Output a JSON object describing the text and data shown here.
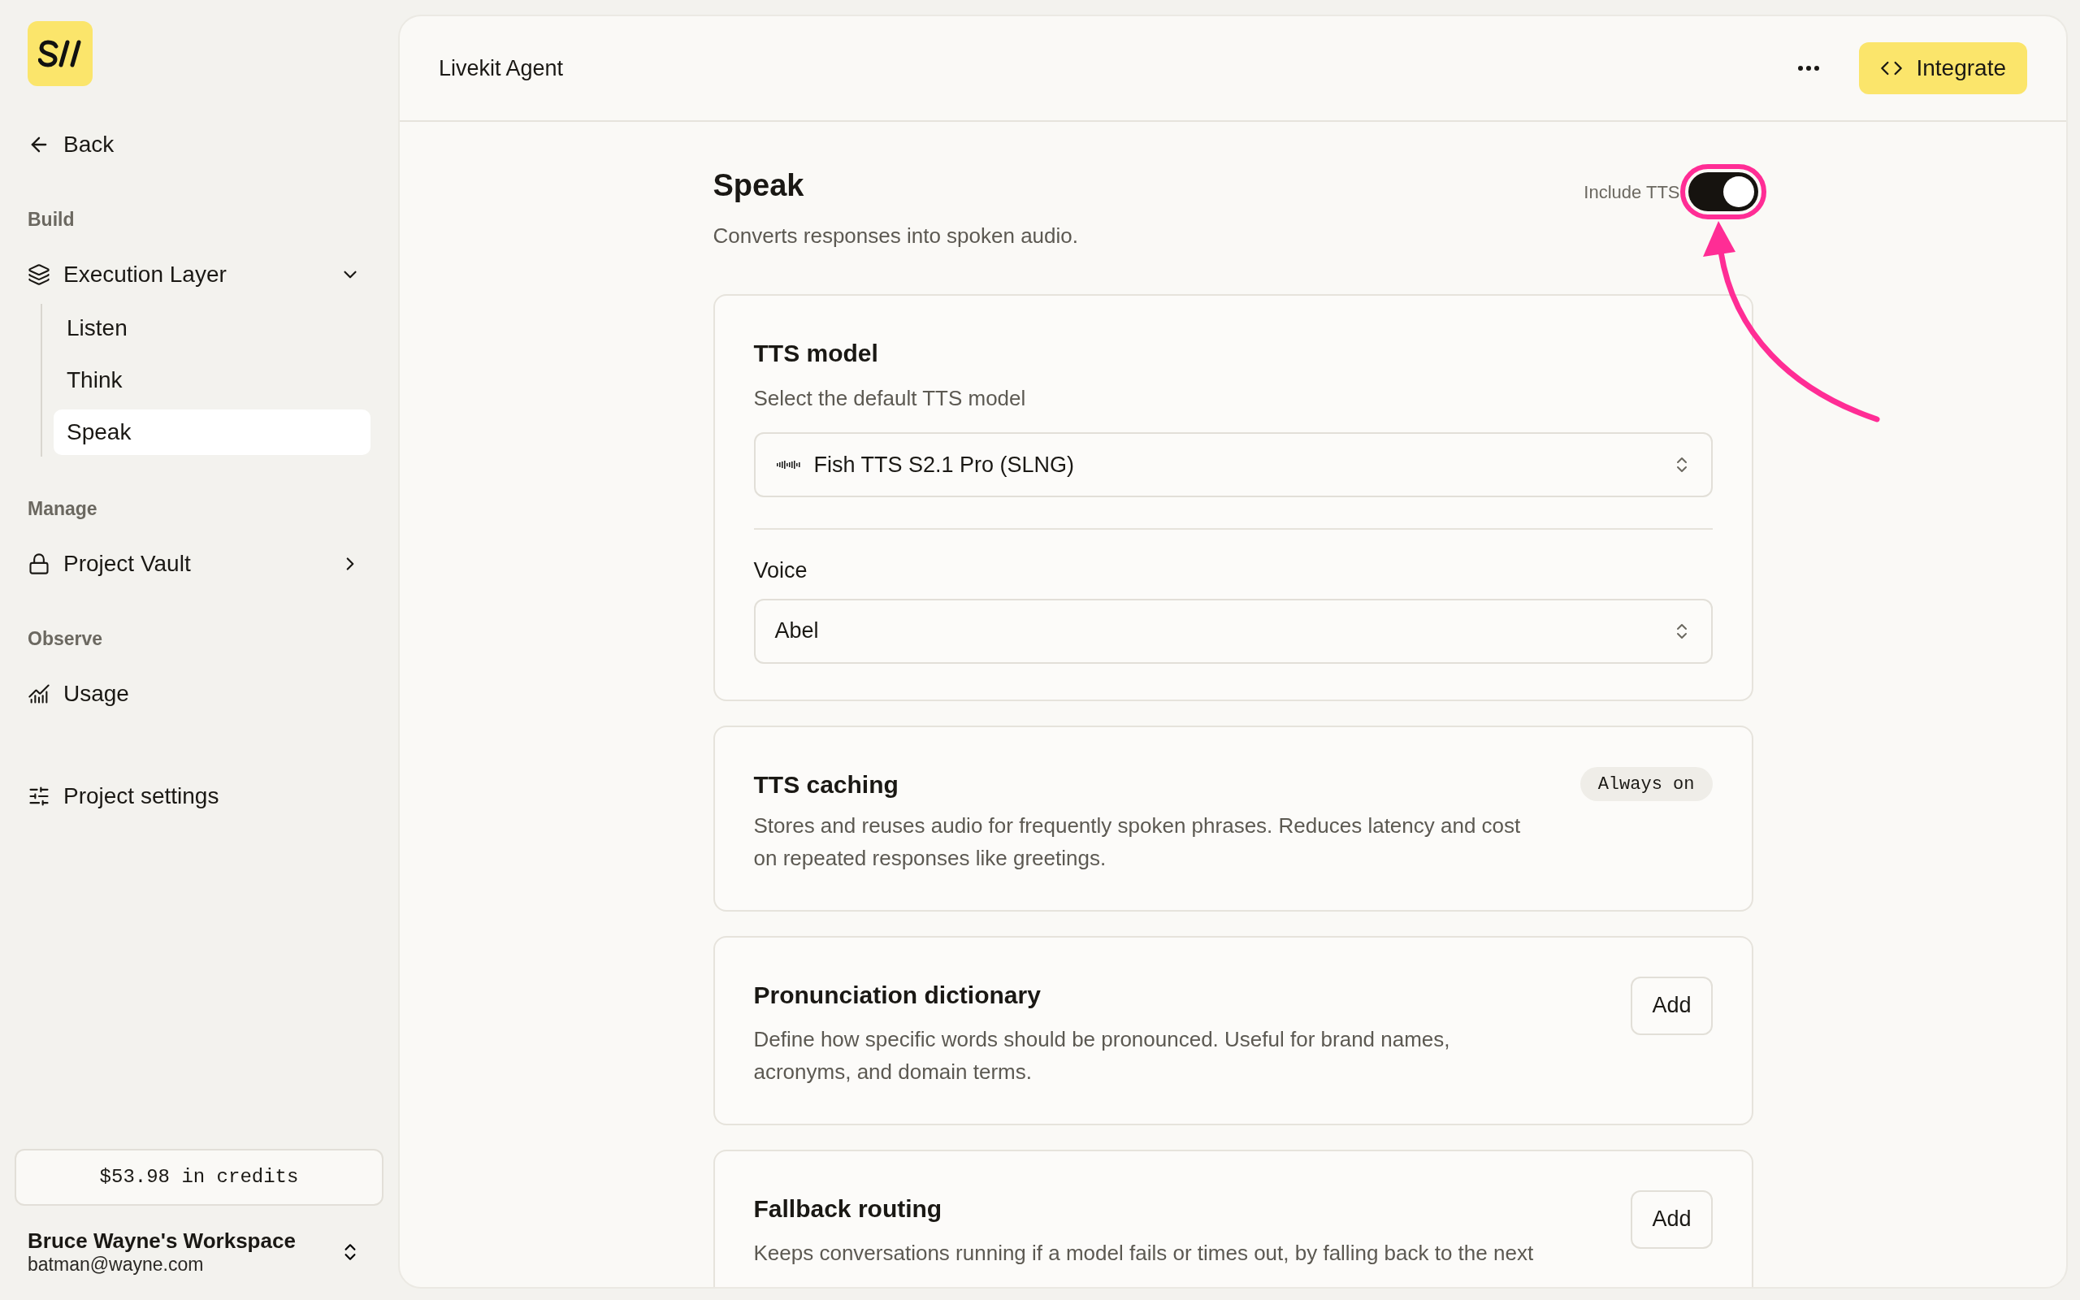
{
  "sidebar": {
    "back": "Back",
    "sections": [
      {
        "heading": "Build",
        "items": [
          {
            "label": "Execution Layer",
            "expanded": true,
            "children": [
              {
                "label": "Listen",
                "selected": false
              },
              {
                "label": "Think",
                "selected": false
              },
              {
                "label": "Speak",
                "selected": true
              }
            ]
          }
        ]
      },
      {
        "heading": "Manage",
        "items": [
          {
            "label": "Project Vault",
            "expanded": false
          }
        ]
      },
      {
        "heading": "Observe",
        "items": [
          {
            "label": "Usage"
          }
        ]
      },
      {
        "items": [
          {
            "label": "Project settings"
          }
        ]
      }
    ],
    "credits": "$53.98 in credits",
    "workspace": {
      "name": "Bruce Wayne's Workspace",
      "email": "batman@wayne.com"
    }
  },
  "header": {
    "title": "Livekit Agent",
    "action": "Integrate"
  },
  "page": {
    "title": "Speak",
    "subtitle": "Converts responses into spoken audio.",
    "toggle_label": "Include TTS",
    "toggle_on": true
  },
  "cards": [
    {
      "kind": "selects",
      "title": "TTS model",
      "subtitle": "Select the default TTS model",
      "model": "Fish TTS S2.1 Pro (SLNG)",
      "voice_label": "Voice",
      "voice": "Abel"
    },
    {
      "kind": "badge",
      "title": "TTS caching",
      "badge": "Always on",
      "description": "Stores and reuses audio for frequently spoken phrases. Reduces latency and cost on repeated responses like greetings."
    },
    {
      "kind": "add",
      "title": "Pronunciation dictionary",
      "button": "Add",
      "description": "Define how specific words should be pronounced. Useful for brand names, acronyms, and domain terms."
    },
    {
      "kind": "add",
      "title": "Fallback routing",
      "button": "Add",
      "description": "Keeps conversations running if a model fails or times out, by falling back to the next"
    }
  ]
}
